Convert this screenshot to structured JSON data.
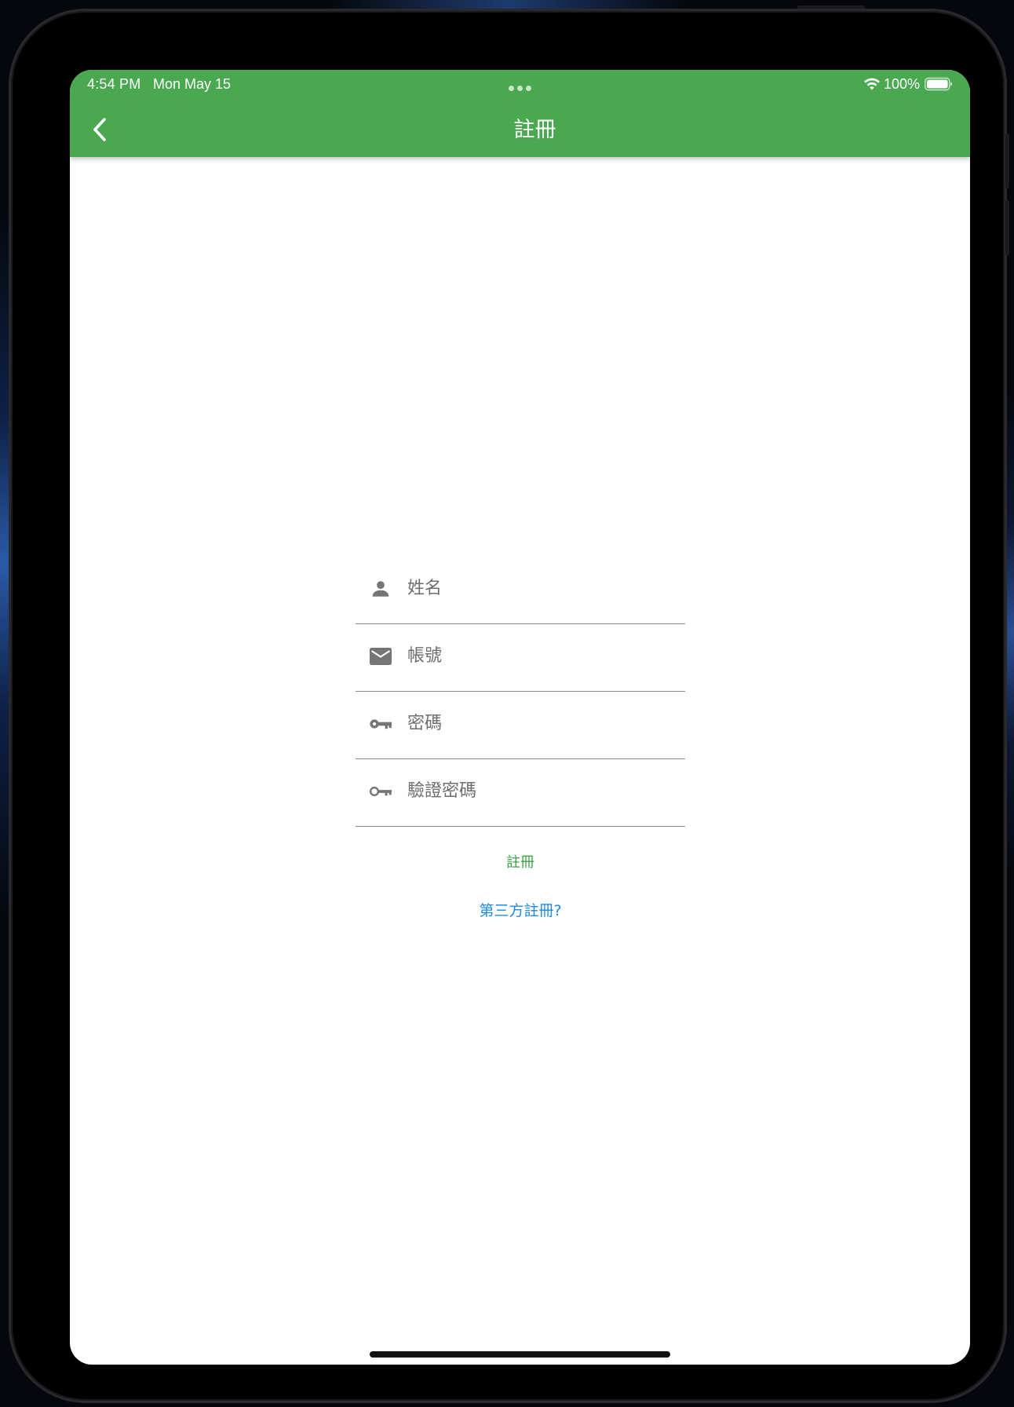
{
  "status_bar": {
    "time": "4:54 PM",
    "date": "Mon May 15",
    "battery": "100%",
    "icons": [
      "wifi-icon",
      "battery-icon",
      "more-dots-icon"
    ]
  },
  "app_bar": {
    "title": "註冊",
    "back_icon": "chevron-left-icon",
    "background_color": "#4aa851"
  },
  "form": {
    "fields": [
      {
        "placeholder": "姓名",
        "icon": "person-icon",
        "value": ""
      },
      {
        "placeholder": "帳號",
        "icon": "mail-icon",
        "value": ""
      },
      {
        "placeholder": "密碼",
        "icon": "key-icon",
        "value": ""
      },
      {
        "placeholder": "驗證密碼",
        "icon": "key-icon",
        "value": ""
      }
    ],
    "submit_label": "註冊",
    "third_party_label": "第三方註冊?"
  },
  "colors": {
    "accent_green": "#3ca345",
    "link_blue": "#1e88e5",
    "icon_gray": "#757575"
  }
}
